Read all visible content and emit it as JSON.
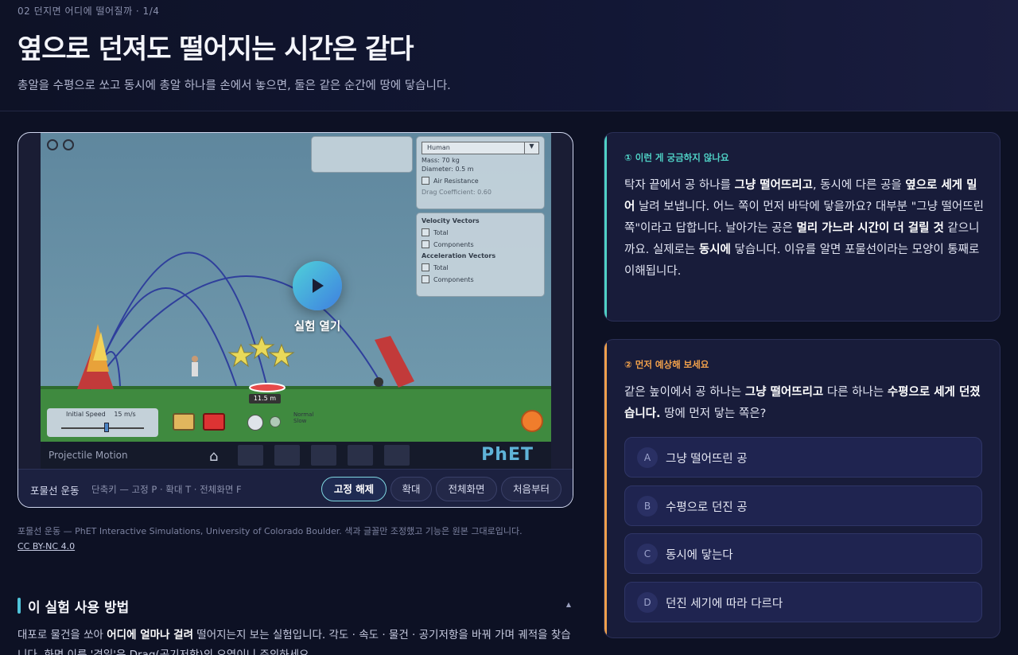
{
  "header": {
    "breadcrumb": "02 던지면 어디에 떨어질까 · 1/4",
    "title": "옆으로 던져도 떨어지는 시간은 같다",
    "subtitle": "총알을 수평으로 쏘고 동시에 총알 하나를 손에서 놓으면, 둘은 같은 순간에 땅에 닿습니다."
  },
  "sim": {
    "play_label": "실험 열기",
    "bottom_label": "Projectile Motion",
    "logo": "PhET",
    "panel_select": "Human",
    "panel_mass": "Mass: 70 kg",
    "panel_diameter": "Diameter: 0.5 m",
    "panel_air": "Air Resistance",
    "panel_drag": "Drag Coefficient: 0.60",
    "velocity_head": "Velocity Vectors",
    "acceleration_head": "Acceleration Vectors",
    "total": "Total",
    "components": "Components",
    "speed_label": "Initial Speed",
    "speed_value": "15 m/s",
    "distance": "11.5 m",
    "radio_normal": "Normal",
    "radio_slow": "Slow"
  },
  "toolbar": {
    "title": "포물선 운동",
    "hint": "단축키 — 고정 P · 확대 T · 전체화면 F",
    "btn_unpin": "고정 해제",
    "btn_zoom": "확대",
    "btn_fullscreen": "전체화면",
    "btn_restart": "처음부터"
  },
  "credit": {
    "text": "포물선 운동 — PhET Interactive Simulations, University of Colorado Boulder. 색과 글꼴만 조정했고 기능은 원본 그대로입니다.",
    "license": "CC BY-NC 4.0"
  },
  "howto": {
    "title": "이 실험 사용 방법",
    "toggle": "▲",
    "body_pre": "대포로 물건을 쏘아 ",
    "body_bold1": "어디에 얼마나 걸려",
    "body_mid": " 떨어지는지 보는 실험입니다. 각도 · 속도 · 물건 · 공기저항을 바꿔 가며 궤적을 찾습니다. 화면 이름 '경일'은 Drag(공기저항)의 오역이니 주의하세요."
  },
  "card1": {
    "head": "① 이런 게 궁금하지 않나요",
    "accent": "#4fd1c5",
    "t1": "탁자 끝에서 공 하나를 ",
    "b1": "그냥 떨어뜨리고",
    "t2": ", 동시에 다른 공을 ",
    "b2": "옆으로 세게 밀어",
    "t3": " 날려 보냅니다. 어느 쪽이 먼저 바닥에 닿을까요? 대부분 \"그냥 떨어뜨린 쪽\"이라고 답합니다. 날아가는 공은 ",
    "b3": "멀리 가느라 시간이 더 걸릴 것",
    "t4": " 같으니까요. 실제로는 ",
    "b4": "동시에",
    "t5": " 닿습니다. 이유를 알면 포물선이라는 모양이 통째로 이해됩니다."
  },
  "card2": {
    "head": "② 먼저 예상해 보세요",
    "accent": "#f0a04b",
    "t1": "같은 높이에서 공 하나는 ",
    "b1": "그냥 떨어뜨리고",
    "t2": " 다른 하나는 ",
    "b2": "수평으로 세게 던졌습니다.",
    "t3": " 땅에 먼저 닿는 쪽은?",
    "options": [
      {
        "letter": "A",
        "label": "그냥 떨어뜨린 공"
      },
      {
        "letter": "B",
        "label": "수평으로 던진 공"
      },
      {
        "letter": "C",
        "label": "동시에 닿는다"
      },
      {
        "letter": "D",
        "label": "던진 세기에 따라 다르다"
      }
    ]
  }
}
